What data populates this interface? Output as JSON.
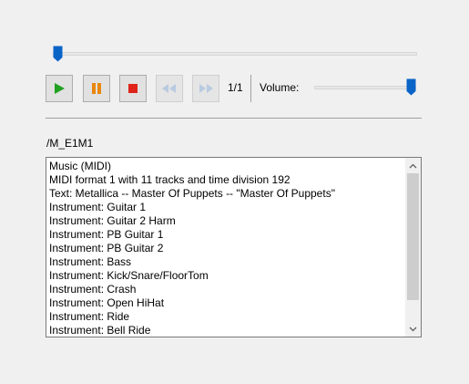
{
  "transport": {
    "play_icon": "play-icon",
    "pause_icon": "pause-icon",
    "stop_icon": "stop-icon",
    "rewind_icon": "rewind-icon",
    "fast_forward_icon": "fast-forward-icon",
    "track_counter": "1/1",
    "play_color": "#21a121",
    "pause_color": "#e8870f",
    "stop_color": "#e0231a",
    "disabled_color": "#b9cbe0"
  },
  "seek": {
    "position_fraction": 0.0
  },
  "volume": {
    "label": "Volume:",
    "level_fraction": 1.0
  },
  "accent_color": "#0a64c8",
  "file": {
    "path": "/M_E1M1"
  },
  "info": {
    "lines": [
      "Music (MIDI)",
      "MIDI format 1 with 11 tracks and time division 192",
      "Text: Metallica -- Master Of Puppets -- \"Master Of Puppets\"",
      "Instrument: Guitar 1",
      "Instrument: Guitar 2 Harm",
      "Instrument: PB Guitar 1",
      "Instrument: PB Guitar 2",
      "Instrument: Bass",
      "Instrument: Kick/Snare/FloorTom",
      "Instrument: Crash",
      "Instrument: Open HiHat",
      "Instrument: Ride",
      "Instrument: Bell Ride"
    ]
  }
}
